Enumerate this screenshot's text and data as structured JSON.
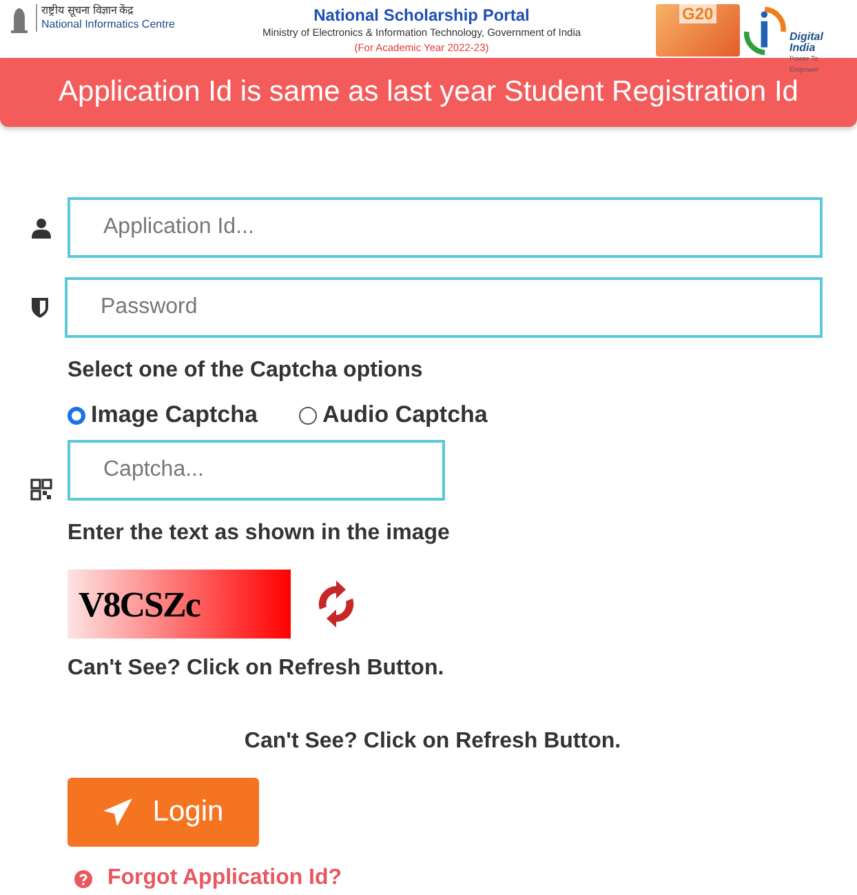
{
  "header": {
    "nic_hindi": "राष्ट्रीय सूचना विज्ञान केंद्र",
    "nic_name": "National Informatics Centre",
    "title": "National Scholarship Portal",
    "ministry": "Ministry of Electronics & Information Technology, Government of India",
    "academic_year": "(For Academic Year 2022-23)",
    "g20_label": "G20",
    "digital_india": "Digital India",
    "digital_india_tagline": "Power To Empower"
  },
  "banner": "Application Id is same as last year Student Registration Id",
  "fields": [
    {
      "kind": "user",
      "placeholder": "Application Id..."
    },
    {
      "kind": "password",
      "placeholder": "Password"
    }
  ],
  "captcha_heading": "Select one of the Captcha options",
  "captcha_options": [
    {
      "label": "Image Captcha",
      "selected": true
    },
    {
      "label": "Audio Captcha",
      "selected": false
    }
  ],
  "captcha_field": {
    "placeholder": "Captcha..."
  },
  "captcha_instruction": "Enter the text as shown in the image",
  "captcha_code": "V8CSZc",
  "refresh_hint": "Can't See? Click on Refresh Button.",
  "refresh_hint_centered": "Can't See? Click on Refresh Button.",
  "login_button": "Login",
  "forgot_link": "Forgot Application Id?"
}
